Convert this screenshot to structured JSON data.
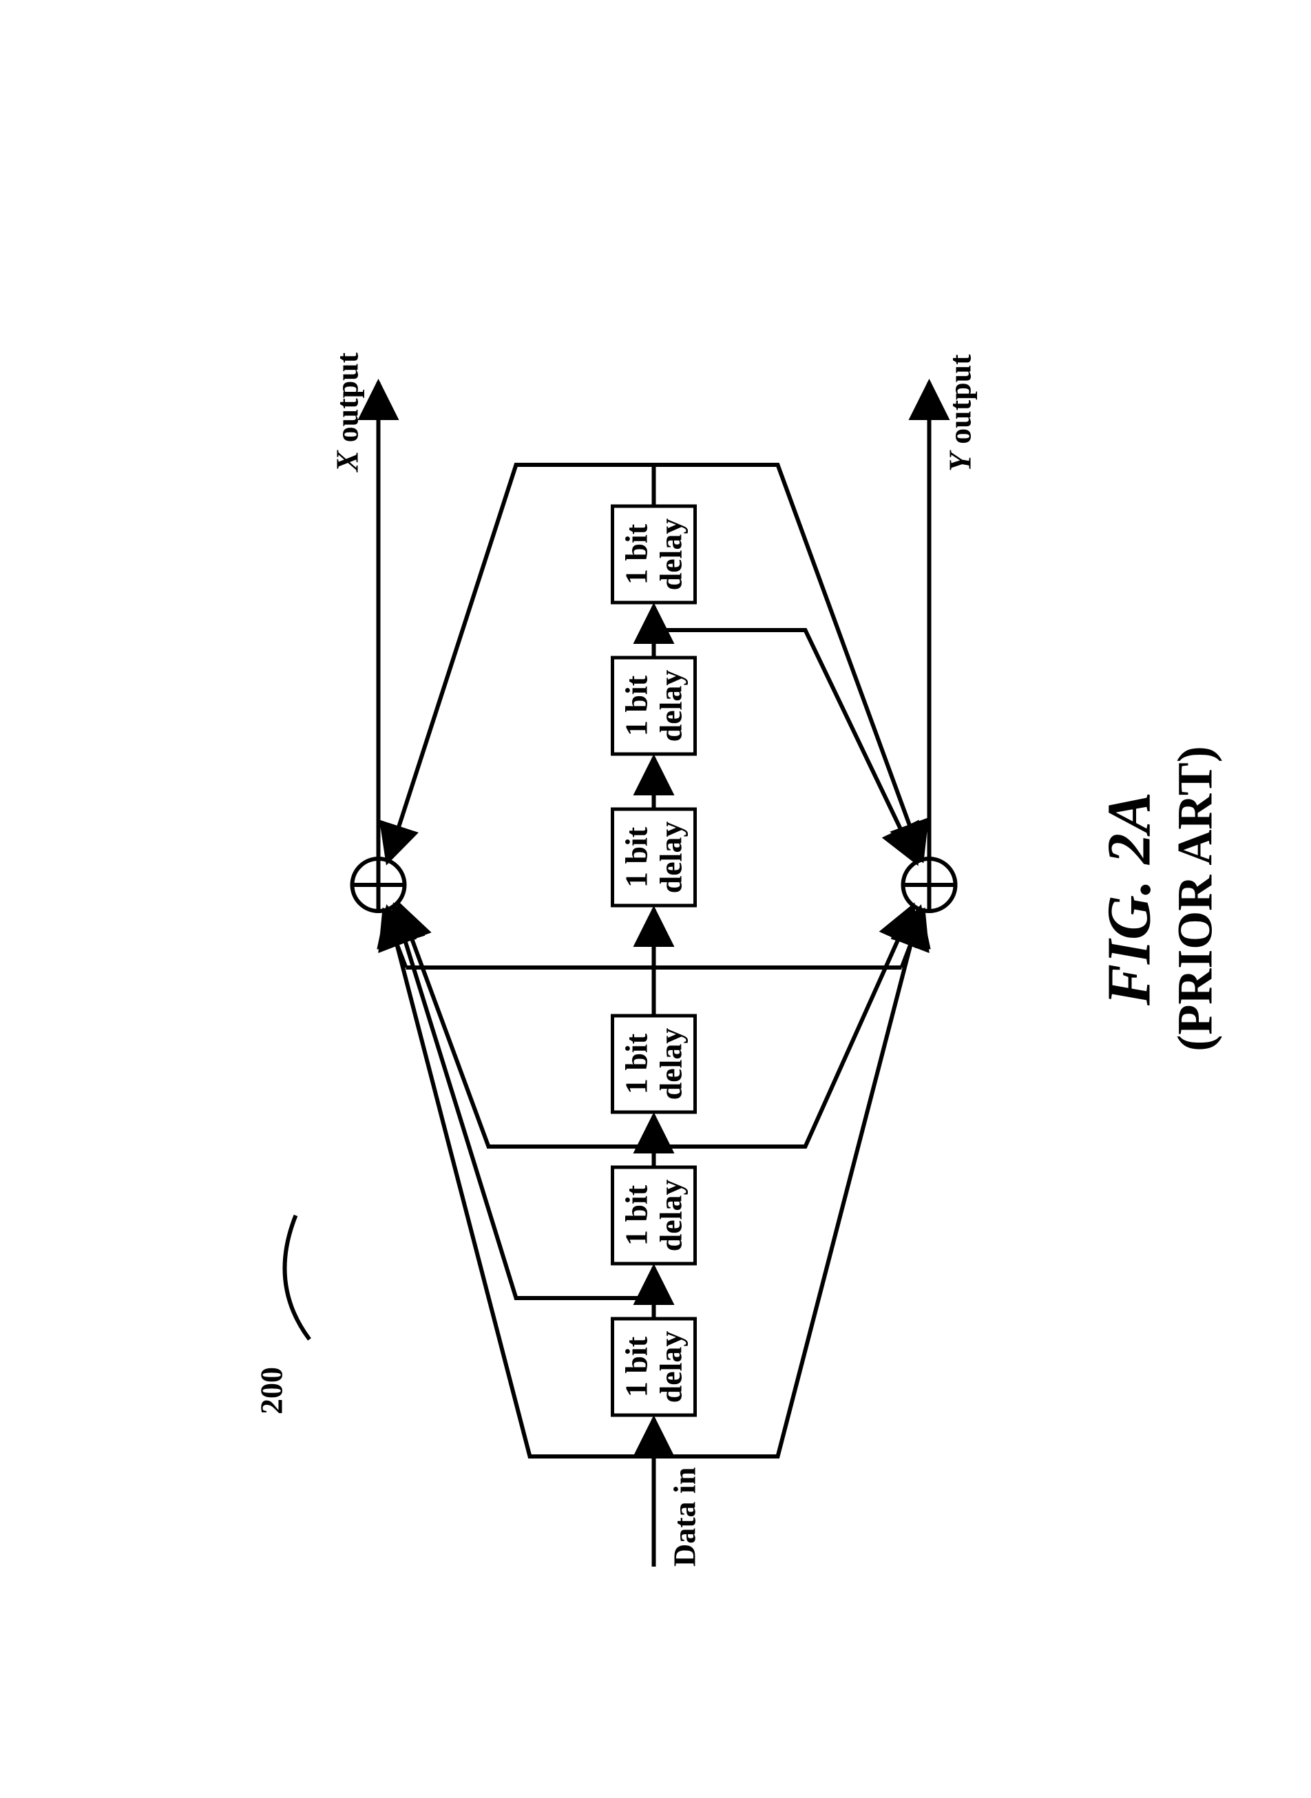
{
  "ref": "200",
  "input_label": "Data in",
  "outputs": {
    "x": {
      "sym": "X",
      "word": "output"
    },
    "y": {
      "sym": "Y",
      "word": "output"
    }
  },
  "delay_block": {
    "line1": "1 bit",
    "line2": "delay"
  },
  "figure": {
    "title": "FIG. 2A",
    "subtitle": "(PRIOR ART)"
  }
}
